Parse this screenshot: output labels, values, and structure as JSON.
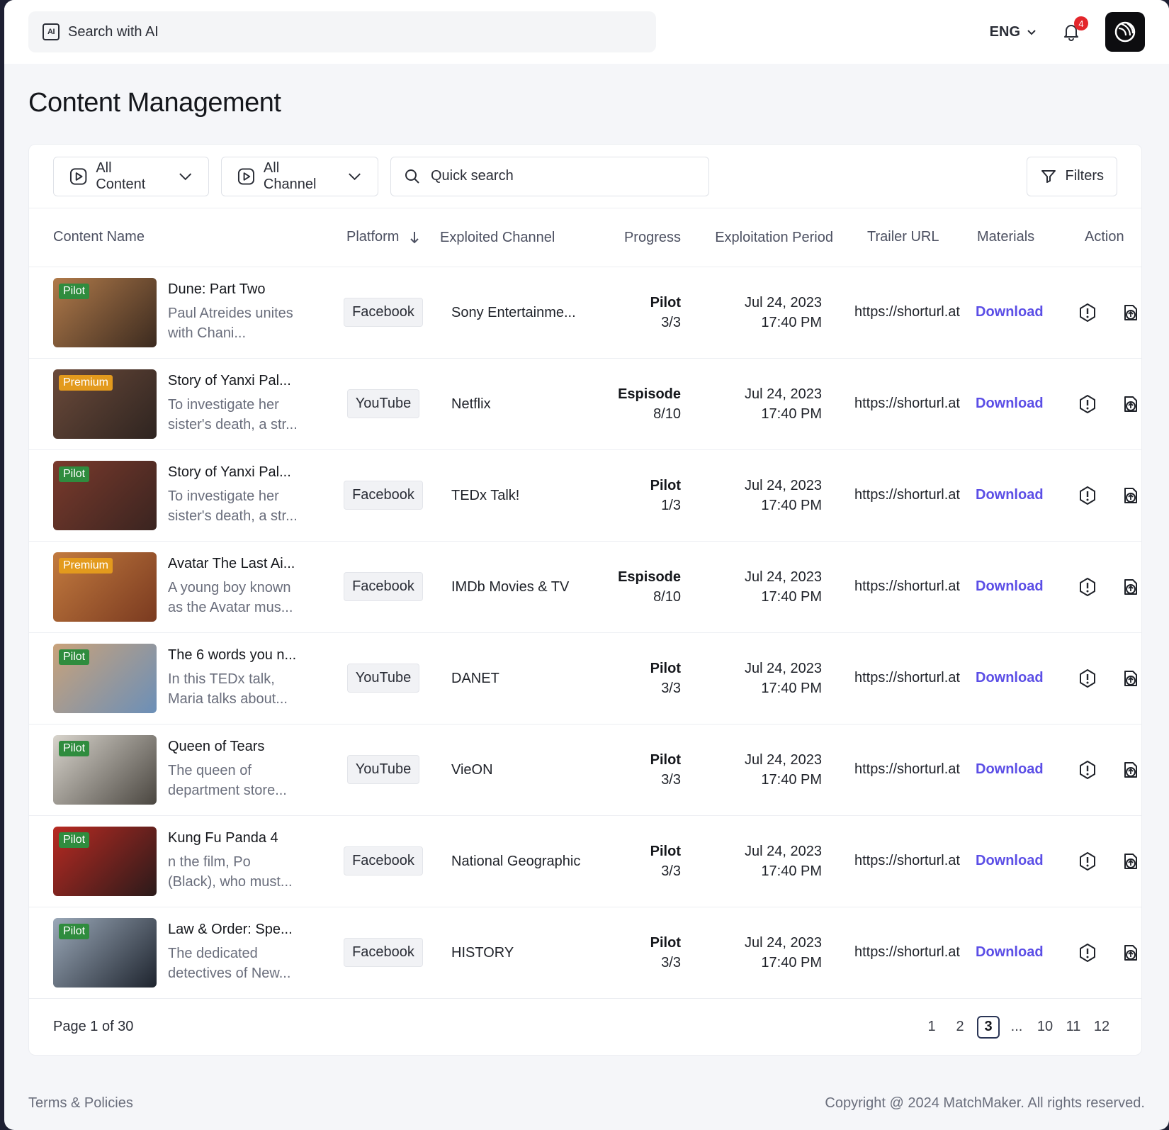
{
  "topbar": {
    "search_label": "Search with AI",
    "ai_icon_text": "AI",
    "language": "ENG",
    "notification_count": "4"
  },
  "page": {
    "title": "Content Management"
  },
  "toolbar": {
    "content_dropdown": "All Content",
    "channel_dropdown": "All Channel",
    "quick_search_placeholder": "Quick search",
    "filters_label": "Filters"
  },
  "table": {
    "headers": {
      "content_name": "Content Name",
      "platform": "Platform",
      "exploited_channel": "Exploited Channel",
      "progress": "Progress",
      "exploitation_period": "Exploitation Period",
      "trailer_url": "Trailer URL",
      "materials": "Materials",
      "action": "Action"
    },
    "rows": [
      {
        "tag": "Pilot",
        "tag_type": "pilot",
        "title": "Dune: Part Two",
        "desc": "Paul Atreides unites with Chani...",
        "platform": "Facebook",
        "channel": "Sony Entertainme...",
        "progress_label": "Pilot",
        "progress_value": "3/3",
        "date": "Jul 24, 2023",
        "time": "17:40 PM",
        "trailer": "https://shorturl.at",
        "materials": "Download",
        "thumb_colors": [
          "#b07a4a",
          "#3b2a1f"
        ]
      },
      {
        "tag": "Premium",
        "tag_type": "premium",
        "title": "Story of Yanxi Pal...",
        "desc": "To investigate her sister's death, a str...",
        "platform": "YouTube",
        "channel": "Netflix",
        "progress_label": "Espisode",
        "progress_value": "8/10",
        "date": "Jul 24, 2023",
        "time": "17:40 PM",
        "trailer": "https://shorturl.at",
        "materials": "Download",
        "thumb_colors": [
          "#6b4a3a",
          "#2e2420"
        ]
      },
      {
        "tag": "Pilot",
        "tag_type": "pilot",
        "title": "Story of Yanxi Pal...",
        "desc": "To investigate her sister's death, a str...",
        "platform": "Facebook",
        "channel": "TEDx Talk!",
        "progress_label": "Pilot",
        "progress_value": "1/3",
        "date": "Jul 24, 2023",
        "time": "17:40 PM",
        "trailer": "https://shorturl.at",
        "materials": "Download",
        "thumb_colors": [
          "#7a3a2c",
          "#3a2420"
        ]
      },
      {
        "tag": "Premium",
        "tag_type": "premium",
        "title": "Avatar The Last Ai...",
        "desc": "A young boy known as the Avatar mus...",
        "platform": "Facebook",
        "channel": "IMDb Movies & TV",
        "progress_label": "Espisode",
        "progress_value": "8/10",
        "date": "Jul 24, 2023",
        "time": "17:40 PM",
        "trailer": "https://shorturl.at",
        "materials": "Download",
        "thumb_colors": [
          "#c27a3e",
          "#7a3a20"
        ]
      },
      {
        "tag": "Pilot",
        "tag_type": "pilot",
        "title": "The 6 words you n...",
        "desc": "In this TEDx talk, Maria talks about...",
        "platform": "YouTube",
        "channel": "DANET",
        "progress_label": "Pilot",
        "progress_value": "3/3",
        "date": "Jul 24, 2023",
        "time": "17:40 PM",
        "trailer": "https://shorturl.at",
        "materials": "Download",
        "thumb_colors": [
          "#c9a27a",
          "#6b8fb8"
        ]
      },
      {
        "tag": "Pilot",
        "tag_type": "pilot",
        "title": "Queen of Tears",
        "desc": "The queen of department store...",
        "platform": "YouTube",
        "channel": "VieON",
        "progress_label": "Pilot",
        "progress_value": "3/3",
        "date": "Jul 24, 2023",
        "time": "17:40 PM",
        "trailer": "https://shorturl.at",
        "materials": "Download",
        "thumb_colors": [
          "#d8d4cc",
          "#4a4640"
        ]
      },
      {
        "tag": "Pilot",
        "tag_type": "pilot",
        "title": "Kung Fu Panda 4",
        "desc": "n the film, Po (Black), who must...",
        "platform": "Facebook",
        "channel": "National Geographic",
        "progress_label": "Pilot",
        "progress_value": "3/3",
        "date": "Jul 24, 2023",
        "time": "17:40 PM",
        "trailer": "https://shorturl.at",
        "materials": "Download",
        "thumb_colors": [
          "#b82a22",
          "#2a1a1a"
        ]
      },
      {
        "tag": "Pilot",
        "tag_type": "pilot",
        "title": "Law & Order: Spe...",
        "desc": "The dedicated detectives of New...",
        "platform": "Facebook",
        "channel": "HISTORY",
        "progress_label": "Pilot",
        "progress_value": "3/3",
        "date": "Jul 24, 2023",
        "time": "17:40 PM",
        "trailer": "https://shorturl.at",
        "materials": "Download",
        "thumb_colors": [
          "#9aa8b8",
          "#1e242e"
        ]
      }
    ]
  },
  "pagination": {
    "info": "Page 1 of 30",
    "pages": [
      "1",
      "2",
      "3",
      "...",
      "10",
      "11",
      "12"
    ],
    "active": "3"
  },
  "footer": {
    "terms": "Terms & Policies",
    "copyright": "Copyright @ 2024 MatchMaker. All rights reserved."
  },
  "colors": {
    "accent": "#5b4ee6",
    "pilot_tag": "#2f8c3e",
    "premium_tag": "#e39a1d",
    "badge": "#e3262b"
  }
}
